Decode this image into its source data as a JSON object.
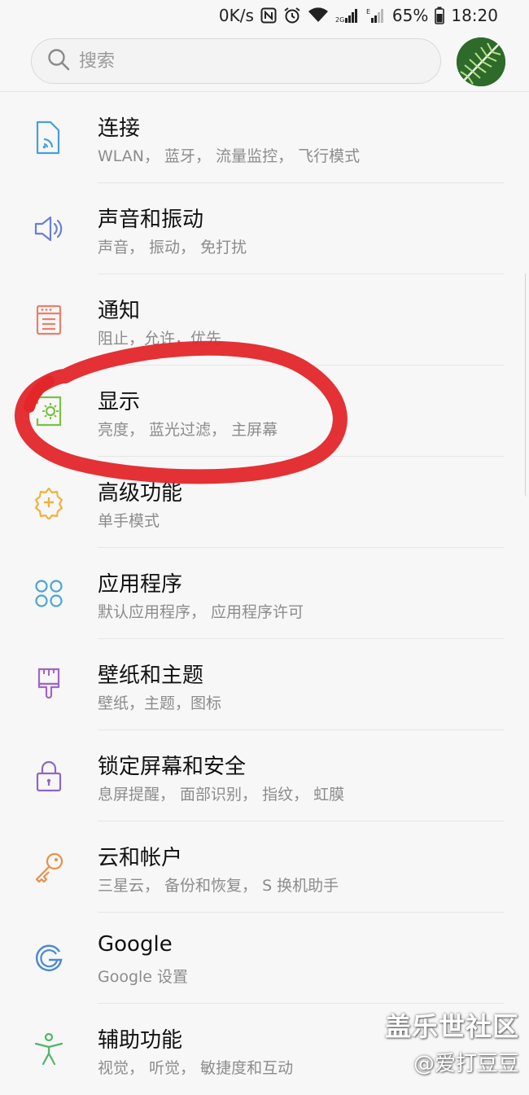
{
  "status_bar": {
    "net_speed": "0K/s",
    "battery_percent": "65%",
    "time": "18:20",
    "icons": [
      "nfc-icon",
      "alarm-icon",
      "wifi-icon",
      "signal-2g-icon",
      "signal-e-icon",
      "battery-icon"
    ]
  },
  "search": {
    "placeholder": "搜索"
  },
  "items": [
    {
      "title": "连接",
      "subtitle": "WLAN， 蓝牙， 流量监控， 飞行模式",
      "icon": "connections-icon",
      "color": "#4a9fd8"
    },
    {
      "title": "声音和振动",
      "subtitle": "声音， 振动， 免打扰",
      "icon": "speaker-icon",
      "color": "#6b7fd4"
    },
    {
      "title": "通知",
      "subtitle": "阻止，允许，优先",
      "icon": "notification-icon",
      "color": "#e8806a"
    },
    {
      "title": "显示",
      "subtitle": "亮度， 蓝光过滤， 主屏幕",
      "icon": "display-icon",
      "color": "#7ac143"
    },
    {
      "title": "高级功能",
      "subtitle": "单手模式",
      "icon": "advanced-features-icon",
      "color": "#f0b23c"
    },
    {
      "title": "应用程序",
      "subtitle": "默认应用程序， 应用程序许可",
      "icon": "apps-icon",
      "color": "#4aa6d6"
    },
    {
      "title": "壁纸和主题",
      "subtitle": "壁纸，主题，图标",
      "icon": "brush-icon",
      "color": "#a066c8"
    },
    {
      "title": "锁定屏幕和安全",
      "subtitle": "息屏提醒， 面部识别， 指纹， 虹膜",
      "icon": "lock-icon",
      "color": "#8e67c4"
    },
    {
      "title": "云和帐户",
      "subtitle": "三星云， 备份和恢复， S 换机助手",
      "icon": "key-icon",
      "color": "#e9904a"
    },
    {
      "title": "Google",
      "subtitle": "Google 设置",
      "icon": "google-icon",
      "color": "#4a88d6"
    },
    {
      "title": "辅助功能",
      "subtitle": "视觉， 听觉， 敏捷度和互动",
      "icon": "accessibility-icon",
      "color": "#56b36a"
    }
  ],
  "watermark": {
    "line1": "盖乐世社区",
    "line2": "@爱打豆豆"
  },
  "annotation_color": "#e3262a"
}
